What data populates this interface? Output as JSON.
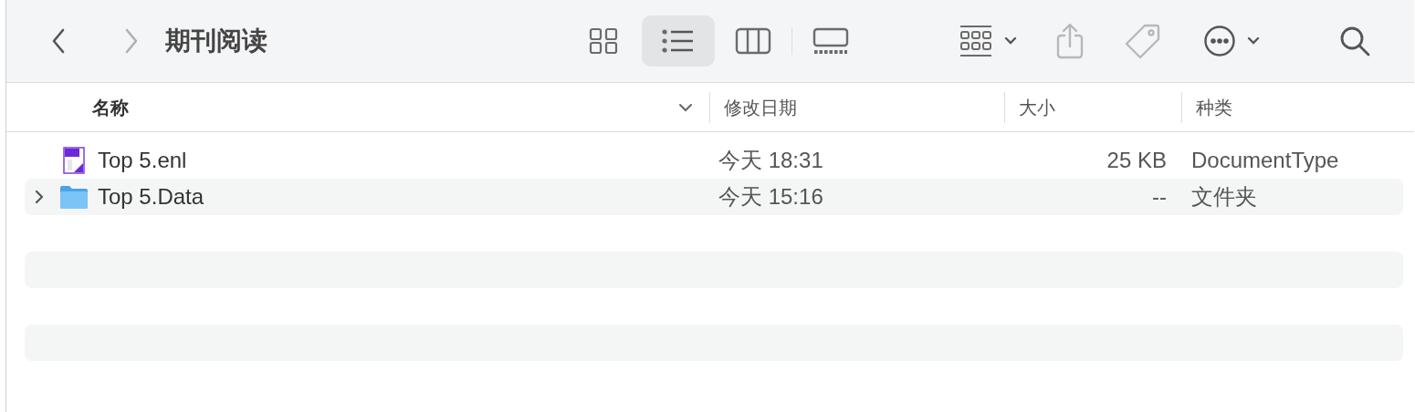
{
  "toolbar": {
    "title": "期刊阅读",
    "views": [
      {
        "kind": "icons",
        "selected": false
      },
      {
        "kind": "list",
        "selected": true
      },
      {
        "kind": "columns",
        "selected": false
      },
      {
        "kind": "gallery",
        "selected": false
      }
    ]
  },
  "table": {
    "columns": [
      "名称",
      "修改日期",
      "大小",
      "种类"
    ],
    "rows": [
      {
        "kind": "file",
        "name": "Top 5.enl",
        "modified": "今天 18:31",
        "size": "25 KB",
        "type": "DocumentType"
      },
      {
        "kind": "folder",
        "expanded": false,
        "name": "Top 5.Data",
        "modified": "今天 15:16",
        "size": "--",
        "type": "文件夹"
      }
    ]
  }
}
